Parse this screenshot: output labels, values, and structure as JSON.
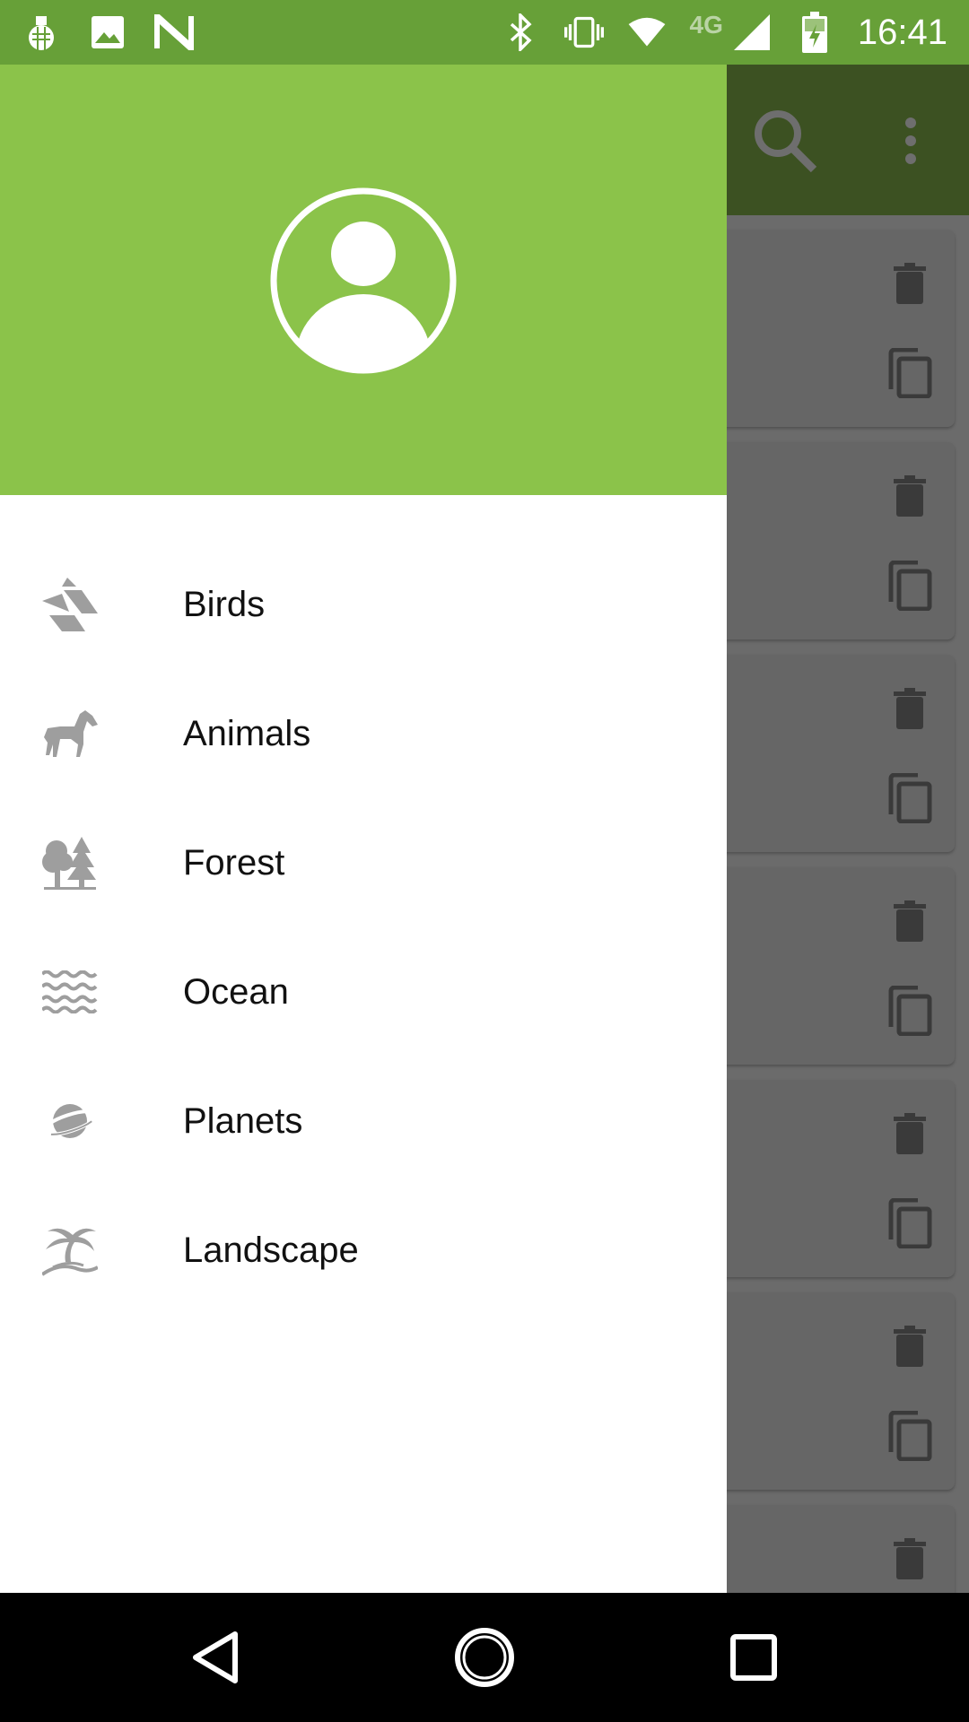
{
  "status_bar": {
    "time": "16:41",
    "network_label": "4G",
    "left_icons": [
      "grenade-icon",
      "image-icon",
      "n-logo-icon"
    ],
    "right_icons": [
      "bluetooth-icon",
      "vibrate-icon",
      "wifi-icon",
      "cell-signal-icon",
      "battery-charging-icon"
    ]
  },
  "toolbar": {
    "icons": [
      "search-icon",
      "more-vert-icon"
    ]
  },
  "drawer": {
    "header_icon": "account-circle-icon",
    "items": [
      {
        "label": "Birds",
        "icon": "origami-bird-icon"
      },
      {
        "label": "Animals",
        "icon": "horse-icon"
      },
      {
        "label": "Forest",
        "icon": "trees-icon"
      },
      {
        "label": "Ocean",
        "icon": "waves-icon"
      },
      {
        "label": "Planets",
        "icon": "planet-icon"
      },
      {
        "label": "Landscape",
        "icon": "palm-island-icon"
      }
    ]
  },
  "cards": {
    "actions": [
      "delete-icon",
      "copy-icon"
    ],
    "count": 7
  },
  "nav_bar": {
    "buttons": [
      "back-icon",
      "home-icon",
      "recents-icon"
    ]
  },
  "colors": {
    "status_bar": "#67a038",
    "drawer_header": "#8bc34a",
    "toolbar_dimmed": "#3c5122",
    "icon_gray": "#9e9e9e"
  }
}
